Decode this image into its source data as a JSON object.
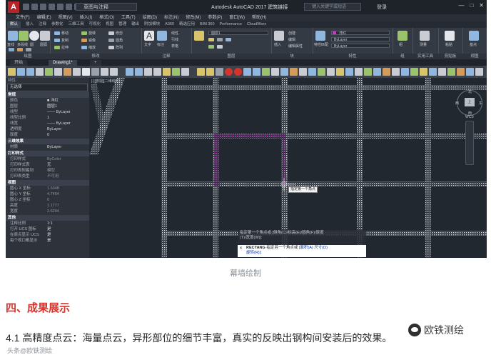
{
  "app": {
    "title": "Autodesk AutoCAD 2017   建筑链接",
    "logo": "A",
    "workspace": "草图与注释",
    "search_placeholder": "键入关键字或短语",
    "signin": "登录",
    "window_controls": [
      "—",
      "□",
      "✕"
    ]
  },
  "menubar": [
    "文件(F)",
    "编辑(E)",
    "视图(V)",
    "插入(I)",
    "格式(O)",
    "工具(T)",
    "绘图(D)",
    "标注(N)",
    "修改(M)",
    "参数(P)",
    "窗口(W)",
    "帮助(H)"
  ],
  "ribbon_tabs": [
    "默认",
    "插入",
    "注释",
    "参数化",
    "三维工具",
    "可视化",
    "视图",
    "管理",
    "输出",
    "附加模块",
    "A360",
    "精选应用",
    "BIM 360",
    "Performance",
    "CloudWorx"
  ],
  "ribbon": {
    "panels": [
      "绘图",
      "修改",
      "注释",
      "图层",
      "块",
      "特性",
      "组",
      "实用工具",
      "剪贴板",
      "视图"
    ],
    "draw_tools": [
      "直线",
      "多段线",
      "圆",
      "圆弧"
    ],
    "modify_tools": [
      "移动",
      "旋转",
      "修剪",
      "复制",
      "镜像",
      "圆角",
      "拉伸",
      "缩放",
      "阵列"
    ],
    "annotation_tools": [
      "文字",
      "标注",
      "线性",
      "引线",
      "表格"
    ],
    "layer_combo": "图层1",
    "insert_label": "插入",
    "block_tools": [
      "创建",
      "编辑",
      "编辑属性"
    ],
    "color_combo": "洋红",
    "linetype_combo": "ByLayer",
    "lineweight_combo": "ByLayer",
    "match_label": "特性匹配",
    "group_label": "组",
    "measure_label": "测量",
    "paste_label": "粘贴",
    "base_label": "基点"
  },
  "doc_tabs": [
    "开始",
    "Drawing1*",
    "+"
  ],
  "properties": {
    "header": "特性",
    "selection": "无选择",
    "sections": [
      {
        "title": "常规",
        "rows": [
          {
            "k": "颜色",
            "v": "■ 洋红"
          },
          {
            "k": "图层",
            "v": "图层1"
          },
          {
            "k": "线型",
            "v": "—— ByLayer"
          },
          {
            "k": "线型比例",
            "v": "1"
          },
          {
            "k": "线宽",
            "v": "—— ByLayer"
          },
          {
            "k": "透明度",
            "v": "ByLayer"
          },
          {
            "k": "厚度",
            "v": "0"
          }
        ]
      },
      {
        "title": "三维效果",
        "rows": [
          {
            "k": "材质",
            "v": "ByLayer"
          }
        ]
      },
      {
        "title": "打印样式",
        "rows": [
          {
            "k": "打印样式",
            "v": "ByColor",
            "dim": true
          },
          {
            "k": "打印样式表",
            "v": "无",
            "dim": false
          },
          {
            "k": "打印表附着到",
            "v": "模型",
            "dim": true
          },
          {
            "k": "打印表类型",
            "v": "不可用",
            "dim": true
          }
        ]
      },
      {
        "title": "视图",
        "rows": [
          {
            "k": "圆心 X 坐标",
            "v": "1.6048",
            "dim": true
          },
          {
            "k": "圆心 Y 坐标",
            "v": "4.7464",
            "dim": true
          },
          {
            "k": "圆心 Z 坐标",
            "v": "0",
            "dim": true
          },
          {
            "k": "高度",
            "v": "1.1777",
            "dim": true
          },
          {
            "k": "宽度",
            "v": "2.6204",
            "dim": true
          }
        ]
      },
      {
        "title": "其他",
        "rows": [
          {
            "k": "注释比例",
            "v": "1:1"
          },
          {
            "k": "打开 UCS 图标",
            "v": "是"
          },
          {
            "k": "在原点显示 UCS",
            "v": "是"
          },
          {
            "k": "每个视口都显示",
            "v": "是"
          }
        ]
      }
    ]
  },
  "canvas": {
    "viewport_label": "[-][俯视][二维线框]",
    "viewcube": {
      "top": "上",
      "n": "北",
      "s": "南",
      "e": "东",
      "w": "西"
    },
    "wcs": "WCS",
    "tooltip": "指定第一个角点",
    "command_history": [
      "指定第一个角点或 [倒角(C)/标高(E)/圆角(F)/厚度",
      "(T)/宽度(W)]:"
    ],
    "command_line": {
      "close": "✕",
      "tool": "RECTANG",
      "prompt": "指定另一个角点或",
      "opts": "[面积(A) 尺寸(D)",
      "opts2": "旋转(R)]:"
    }
  },
  "article": {
    "caption": "幕墙绘制",
    "heading": "四、成果展示",
    "body": "4.1 高精度点云：海量点云，异形部位的细节丰富，真实的反映出钢构间安装后的效果。",
    "watermark": "欧铁测绘",
    "watermark_bottom": "头条@欧铁测绘"
  },
  "colors": {
    "accent_red": "#d5342d",
    "magenta": "#c040c0",
    "point_cloud": "#c9cdd3"
  }
}
